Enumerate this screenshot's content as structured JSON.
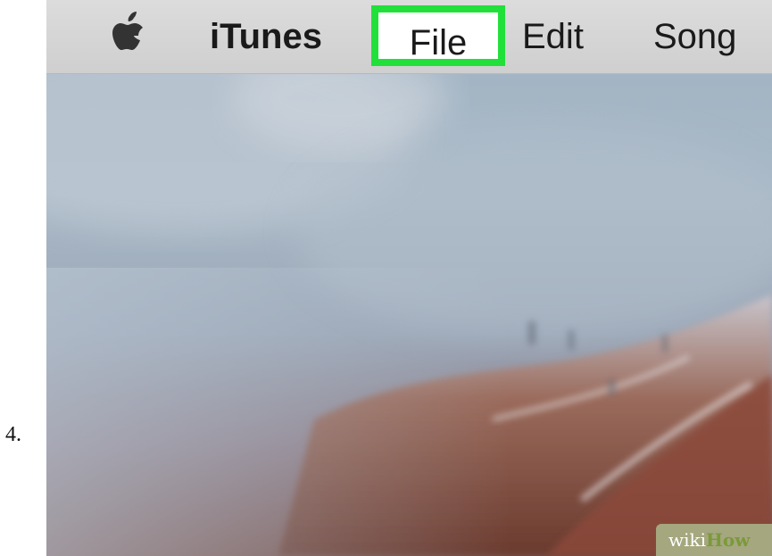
{
  "step": {
    "number_label": "4."
  },
  "menubar": {
    "apple_icon": "apple-logo-icon",
    "items": [
      {
        "label": "iTunes",
        "bold": true
      },
      {
        "label": "File",
        "highlighted": true
      },
      {
        "label": "Edit"
      },
      {
        "label": "Song"
      }
    ]
  },
  "highlight": {
    "color": "#22e03a"
  },
  "watermark": {
    "part1": "wiki",
    "part2": "How"
  }
}
